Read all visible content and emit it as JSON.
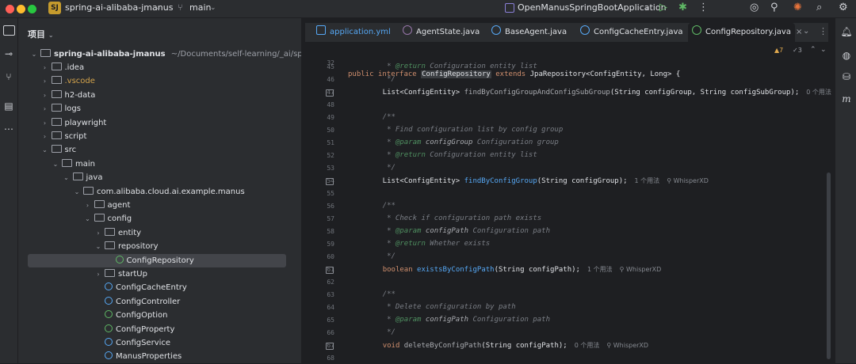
{
  "titlebar": {
    "project_badge": "SJ",
    "project_name": "spring-ai-alibaba-jmanus",
    "branch": "main",
    "run_config": "OpenManusSpringBootApplication",
    "colors": {
      "close": "#ff5f57",
      "minimize": "#febc2e",
      "zoom": "#28c840",
      "run": "#5fb865",
      "debug": "#5fb865"
    }
  },
  "left_toolbar": {
    "icons": [
      "folder-icon",
      "commit-icon",
      "git-branches-icon",
      "structure-icon",
      "more-icon"
    ]
  },
  "project_panel": {
    "title": "项目",
    "root_name": "spring-ai-alibaba-jmanus",
    "root_path": "~/Documents/self-learning/_ai/spring-ai-a",
    "items": [
      {
        "label": "idea",
        "display": ".idea",
        "type": "folder",
        "state": "collapsed",
        "depth": 1
      },
      {
        "label": "vscode",
        "display": ".vscode",
        "type": "folder",
        "state": "collapsed",
        "depth": 1
      },
      {
        "label": "h2-data",
        "display": "h2-data",
        "type": "folder",
        "state": "collapsed",
        "depth": 1
      },
      {
        "label": "logs",
        "display": "logs",
        "type": "folder",
        "state": "collapsed",
        "depth": 1
      },
      {
        "label": "playwright",
        "display": "playwright",
        "type": "folder",
        "state": "collapsed",
        "depth": 1
      },
      {
        "label": "script",
        "display": "script",
        "type": "folder",
        "state": "collapsed",
        "depth": 1
      },
      {
        "label": "src",
        "display": "src",
        "type": "folder",
        "state": "expanded",
        "depth": 1
      },
      {
        "label": "main",
        "display": "main",
        "type": "folder",
        "state": "expanded",
        "depth": 2
      },
      {
        "label": "java",
        "display": "java",
        "type": "folder",
        "state": "expanded",
        "depth": 3
      },
      {
        "label": "package",
        "display": "com.alibaba.cloud.ai.example.manus",
        "type": "package",
        "state": "expanded",
        "depth": 4
      },
      {
        "label": "agent",
        "display": "agent",
        "type": "package",
        "state": "collapsed",
        "depth": 5
      },
      {
        "label": "config",
        "display": "config",
        "type": "package",
        "state": "expanded",
        "depth": 5
      },
      {
        "label": "entity",
        "display": "entity",
        "type": "package",
        "state": "collapsed",
        "depth": 6
      },
      {
        "label": "repository",
        "display": "repository",
        "type": "package",
        "state": "expanded",
        "depth": 6
      },
      {
        "label": "ConfigRepository",
        "display": "ConfigRepository",
        "type": "interface",
        "state": "selected",
        "depth": 7
      },
      {
        "label": "startUp",
        "display": "startUp",
        "type": "package",
        "state": "collapsed",
        "depth": 6
      },
      {
        "label": "ConfigCacheEntry",
        "display": "ConfigCacheEntry",
        "type": "class",
        "state": "leaf",
        "depth": 6
      },
      {
        "label": "ConfigController",
        "display": "ConfigController",
        "type": "class",
        "state": "leaf",
        "depth": 6
      },
      {
        "label": "ConfigOption",
        "display": "ConfigOption",
        "type": "annotation",
        "state": "leaf",
        "depth": 6
      },
      {
        "label": "ConfigProperty",
        "display": "ConfigProperty",
        "type": "annotation",
        "state": "leaf",
        "depth": 6
      },
      {
        "label": "ConfigService",
        "display": "ConfigService",
        "type": "class",
        "state": "leaf",
        "depth": 6
      },
      {
        "label": "ManusProperties",
        "display": "ManusProperties",
        "type": "class",
        "state": "leaf",
        "depth": 6
      }
    ]
  },
  "tabs": [
    {
      "label": "application.yml",
      "icon": "yaml-icon",
      "active": false
    },
    {
      "label": "AgentState.java",
      "icon": "enum-icon",
      "active": false
    },
    {
      "label": "BaseAgent.java",
      "icon": "class-icon",
      "active": false
    },
    {
      "label": "ConfigCacheEntry.java",
      "icon": "class-icon",
      "active": false
    },
    {
      "label": "ConfigRepository.java",
      "icon": "interface-icon",
      "active": true
    }
  ],
  "editor": {
    "sticky_line": {
      "num": "32",
      "text": "public interface ConfigRepository extends JpaRepository<ConfigEntity, Long> {"
    },
    "inspections": {
      "warnings": "7",
      "checks": "3"
    },
    "lines": [
      {
        "num": "45",
        "kind": "comment",
        "text": "     * @return Configuration entity list"
      },
      {
        "num": "46",
        "kind": "comment",
        "text": "     */"
      },
      {
        "num": "47",
        "kind": "code",
        "text": "    List<ConfigEntity> findByConfigGroupAndConfigSubGroup(String configGroup, String configSubGroup);",
        "hint": "0 个用法"
      },
      {
        "num": "48",
        "kind": "blank",
        "text": ""
      },
      {
        "num": "49",
        "kind": "comment",
        "text": "    /**"
      },
      {
        "num": "50",
        "kind": "comment",
        "text": "     * Find configuration list by config group"
      },
      {
        "num": "51",
        "kind": "comment",
        "text": "     * @param configGroup Configuration group"
      },
      {
        "num": "52",
        "kind": "comment",
        "text": "     * @return Configuration entity list"
      },
      {
        "num": "53",
        "kind": "comment",
        "text": "     */"
      },
      {
        "num": "54",
        "kind": "code",
        "text": "    List<ConfigEntity> findByConfigGroup(String configGroup);",
        "hint": "1 个用法",
        "author": "WhisperXD"
      },
      {
        "num": "55",
        "kind": "blank",
        "text": ""
      },
      {
        "num": "56",
        "kind": "comment",
        "text": "    /**"
      },
      {
        "num": "57",
        "kind": "comment",
        "text": "     * Check if configuration path exists"
      },
      {
        "num": "58",
        "kind": "comment",
        "text": "     * @param configPath Configuration path"
      },
      {
        "num": "59",
        "kind": "comment",
        "text": "     * @return Whether exists"
      },
      {
        "num": "60",
        "kind": "comment",
        "text": "     */"
      },
      {
        "num": "61",
        "kind": "code",
        "text": "    boolean existsByConfigPath(String configPath);",
        "hint": "1 个用法",
        "author": "WhisperXD"
      },
      {
        "num": "62",
        "kind": "blank",
        "text": ""
      },
      {
        "num": "63",
        "kind": "comment",
        "text": "    /**"
      },
      {
        "num": "64",
        "kind": "comment",
        "text": "     * Delete configuration by path"
      },
      {
        "num": "65",
        "kind": "comment",
        "text": "     * @param configPath Configuration path"
      },
      {
        "num": "66",
        "kind": "comment",
        "text": "     */"
      },
      {
        "num": "67",
        "kind": "code",
        "text": "    void deleteByConfigPath(String configPath);",
        "hint": "0 个用法",
        "author": "WhisperXD"
      },
      {
        "num": "68",
        "kind": "blank",
        "text": ""
      }
    ]
  },
  "right_toolbar": {
    "icons": [
      "notifications-icon",
      "ai-assistant-icon",
      "database-icon",
      "maven-icon"
    ]
  }
}
